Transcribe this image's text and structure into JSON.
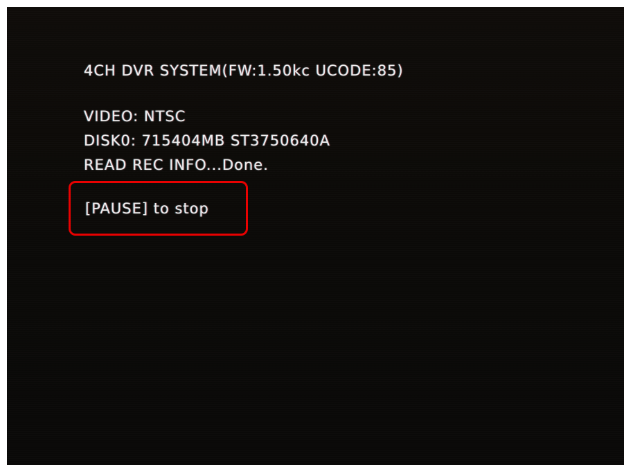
{
  "osd": {
    "title": "4CH DVR SYSTEM(FW:1.50kc UCODE:85)",
    "video": "VIDEO: NTSC",
    "disk": "DISK0: 715404MB ST3750640A",
    "read_status": "READ REC INFO...Done.",
    "prompt": "[PAUSE] to stop"
  },
  "colors": {
    "screen_background": "#0d0b09",
    "text": "#eeeeee",
    "highlight": "#e80000",
    "page_background": "#ffffff"
  }
}
